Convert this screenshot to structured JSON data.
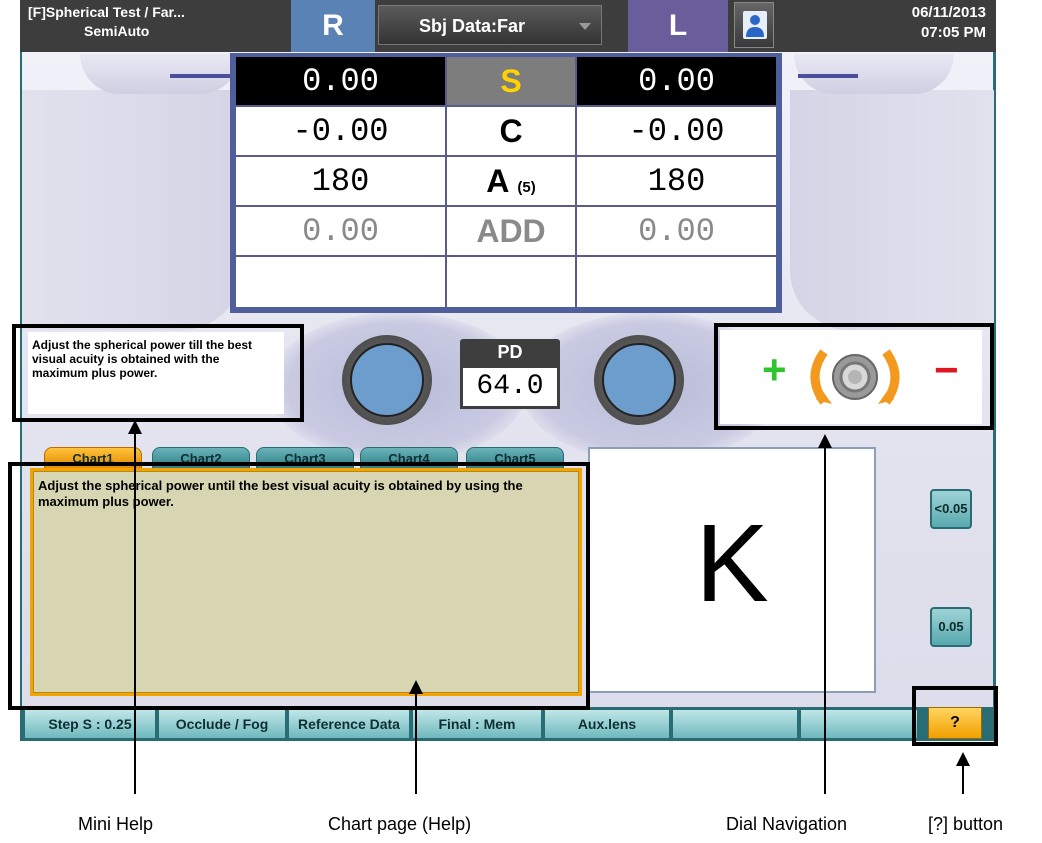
{
  "header": {
    "title_line1": "[F]Spherical Test / Far...",
    "title_line2": "SemiAuto",
    "right_eye_label": "R",
    "data_select": "Sbj Data:Far",
    "left_eye_label": "L",
    "date": "06/11/2013",
    "time": "07:05 PM"
  },
  "refraction": {
    "sph": {
      "right": "0.00",
      "label": "S",
      "left": "0.00"
    },
    "cyl": {
      "right": "-0.00",
      "label": "C",
      "left": "-0.00"
    },
    "axis": {
      "right": "180",
      "label": "A",
      "step": "(5)",
      "left": "180"
    },
    "add": {
      "right": "0.00",
      "label": "ADD",
      "left": "0.00"
    }
  },
  "mini_help": {
    "text": "Adjust the spherical power till the best visual acuity is obtained with the maximum plus power."
  },
  "pd": {
    "label": "PD",
    "value": "64.0"
  },
  "dial": {
    "plus": "+",
    "minus": "−"
  },
  "chart_tabs": [
    "Chart1",
    "Chart2",
    "Chart3",
    "Chart4",
    "Chart5"
  ],
  "chart_help": {
    "text": "Adjust the spherical power until the best visual acuity is obtained by using the maximum plus power."
  },
  "chart_display": {
    "letter": "K"
  },
  "acuity": {
    "upper": "<0.05",
    "lower": "0.05"
  },
  "bottom_bar": {
    "step": "Step S : 0.25",
    "occlude": "Occlude / Fog",
    "reference": "Reference Data",
    "final": "Final : Mem",
    "aux": "Aux.lens",
    "help": "?"
  },
  "annotations": {
    "mini_help": "Mini Help",
    "chart_page": "Chart page (Help)",
    "dial_navigation": "Dial Navigation",
    "help_button": "[?] button"
  },
  "colors": {
    "header_bg": "#3d3d3d",
    "right_eye": "#5a82b4",
    "left_eye": "#6a5d9c",
    "teal_button": "#6fb9be",
    "active_tab": "#f5a300",
    "sph_highlight": "#ffd200"
  },
  "icons": [
    "user-icon",
    "dial-knob-icon",
    "rotate-left-arrow-icon",
    "rotate-right-arrow-icon"
  ]
}
